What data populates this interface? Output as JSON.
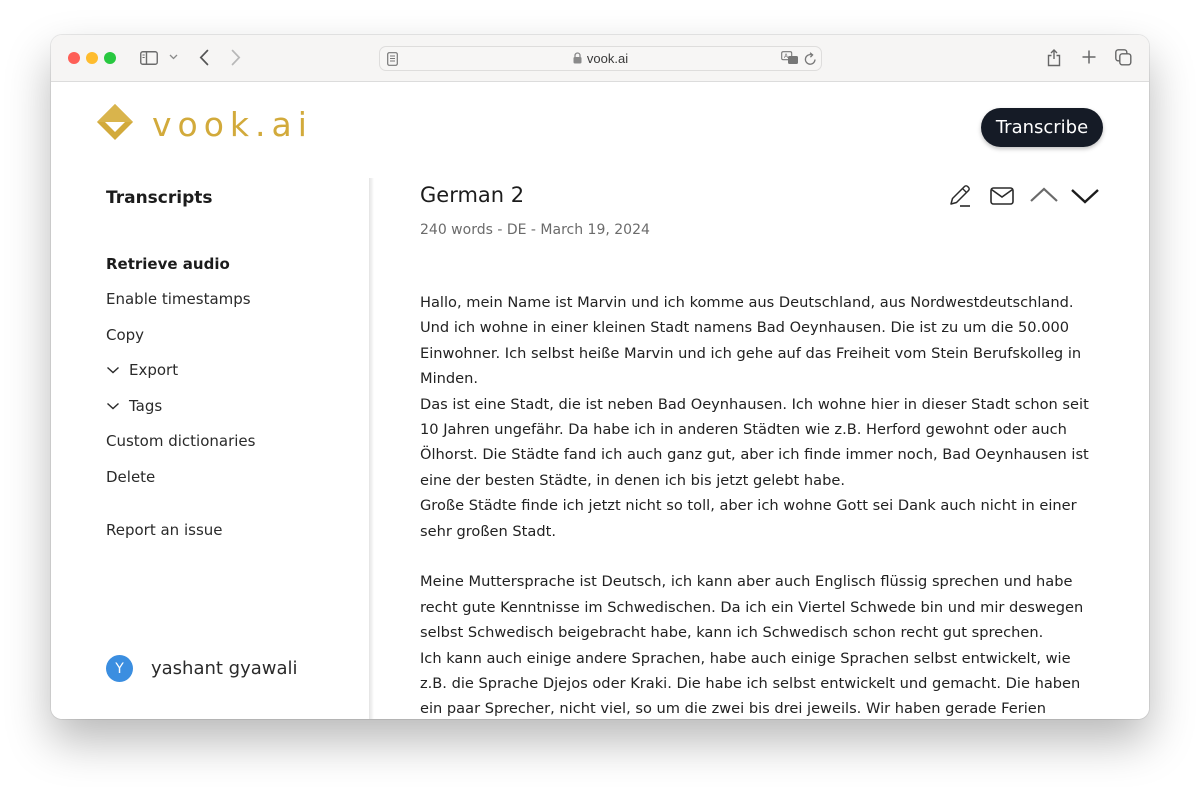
{
  "browser": {
    "url": "vook.ai",
    "icons": {
      "close": "close-window",
      "minimize": "minimize-window",
      "zoom": "zoom-window",
      "sidebar": "sidebar-toggle-icon",
      "back": "back-arrow-icon",
      "forward": "forward-arrow-icon",
      "reader": "reader-mode-icon",
      "lock": "lock-icon",
      "translate": "translate-icon",
      "reload": "reload-icon",
      "share": "share-icon",
      "new_tab": "plus-icon",
      "tabs": "tab-overview-icon"
    }
  },
  "header": {
    "logo_text": "vook.ai",
    "brand_color": "#d2aa3b",
    "transcribe_label": "Transcribe"
  },
  "sidebar": {
    "title": "Transcripts",
    "items": [
      {
        "label": "Retrieve audio",
        "bold": true
      },
      {
        "label": "Enable timestamps"
      },
      {
        "label": "Copy"
      },
      {
        "label": "Export",
        "expandable": true
      },
      {
        "label": "Tags",
        "expandable": true
      },
      {
        "label": "Custom dictionaries"
      },
      {
        "label": "Delete"
      },
      {
        "label": "Report an issue"
      }
    ],
    "user": {
      "initial": "Y",
      "name": "yashant gyawali",
      "avatar_color": "#3b8ee0"
    }
  },
  "document": {
    "title": "German 2",
    "meta": "240 words - DE - March 19, 2024",
    "actions": [
      "edit",
      "email",
      "previous",
      "next"
    ],
    "paragraphs": [
      [
        "Hallo, mein Name ist Marvin und ich komme aus Deutschland, aus Nordwestdeutschland.",
        "Und ich wohne in einer kleinen Stadt namens Bad Oeynhausen. Die ist zu um die 50.000",
        "Einwohner. Ich selbst heiße Marvin und ich gehe auf das Freiheit vom Stein Berufskolleg in",
        "Minden.",
        "Das ist eine Stadt, die ist neben Bad Oeynhausen. Ich wohne hier in dieser Stadt schon seit",
        "10 Jahren ungefähr. Da habe ich in anderen Städten wie z.B. Herford gewohnt oder auch",
        "Ölhorst. Die Städte fand ich auch ganz gut, aber ich finde immer noch, Bad Oeynhausen ist",
        "eine der besten Städte, in denen ich bis jetzt gelebt habe.",
        "Große Städte finde ich jetzt nicht so toll, aber ich wohne Gott sei Dank auch nicht in einer",
        "sehr großen Stadt."
      ],
      [
        "Meine Muttersprache ist Deutsch, ich kann aber auch Englisch flüssig sprechen und habe",
        "recht gute Kenntnisse im Schwedischen. Da ich ein Viertel Schwede bin und mir deswegen",
        "selbst Schwedisch beigebracht habe, kann ich Schwedisch schon recht gut sprechen.",
        "Ich kann auch einige andere Sprachen, habe auch einige Sprachen selbst entwickelt, wie",
        "z.B. die Sprache Djejos oder Kraki. Die habe ich selbst entwickelt und gemacht. Die haben",
        "ein paar Sprecher, nicht viel, so um die zwei bis drei jeweils. Wir haben gerade Ferien"
      ]
    ]
  }
}
